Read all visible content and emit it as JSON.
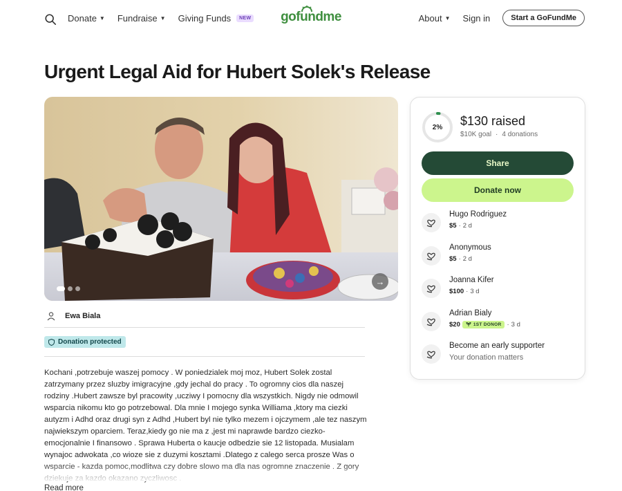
{
  "nav": {
    "donate": "Donate",
    "fundraise": "Fundraise",
    "giving_funds": "Giving Funds",
    "new_badge": "NEW",
    "logo": "gofundme",
    "about": "About",
    "sign_in": "Sign in",
    "start": "Start a GoFundMe"
  },
  "campaign": {
    "title": "Urgent Legal Aid for Hubert Solek's Release",
    "organizer": "Ewa Biala",
    "protected_label": "Donation protected",
    "story": "Kochani ,potrzebuje waszej pomocy . W poniedzialek moj moz, Hubert Solek zostal zatrzymany przez sluzby imigracyjne ,gdy jechal do pracy . To ogromny cios dla naszej rodziny .Hubert zawsze byl pracowity ,ucziwy I pomocny dla wszystkich. Nigdy nie odmowil wsparcia nikomu kto go potrzebowal. Dla mnie I mojego synka Williama ,ktory ma ciezki autyzm i Adhd oraz drugi syn z Adhd ,Hubert byl nie tylko mezem i ojczymem ,ale tez naszym najwiekszym oparciem. Teraz,kiedy go nie ma z ,jest mi naprawde bardzo ciezko- emocjonalnie I finansowo . Sprawa Huberta o kaucje odbedzie sie 12 listopada. Musialam wynajoc adwokata ,co wioze sie z duzymi kosztami .Dlatego z calego serca prosze Was o wsparcie - kazda pomoc,modlitwa czy dobre slowo ma dla nas ogromne znaczenie . Z gory dziekuje za kazdo okazano zyczliwosc .",
    "read_more": "Read more"
  },
  "progress": {
    "percent_label": "2%",
    "fraction": 0.02,
    "raised": "$130 raised",
    "goal": "$10K goal",
    "donations": "4 donations"
  },
  "actions": {
    "share": "Share",
    "donate_now": "Donate now"
  },
  "donors": [
    {
      "name": "Hugo Rodriguez",
      "amount": "$5",
      "when": "2 d"
    },
    {
      "name": "Anonymous",
      "amount": "$5",
      "when": "2 d"
    },
    {
      "name": "Joanna Kifer",
      "amount": "$100",
      "when": "3 d"
    },
    {
      "name": "Adrian Bialy",
      "amount": "$20",
      "badge": "1ST DONOR",
      "when": "3 d"
    }
  ],
  "early": {
    "title": "Become an early supporter",
    "subtitle": "Your donation matters"
  },
  "colors": {
    "brand_green": "#3f8f3f",
    "share_bg": "#244a36",
    "donate_bg": "#ccf58d",
    "protect_bg": "#bfe8ea"
  }
}
